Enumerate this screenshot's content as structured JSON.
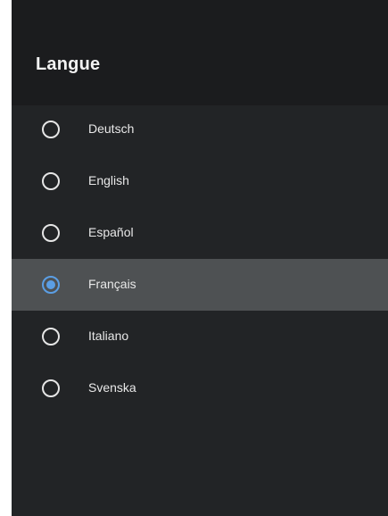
{
  "dialog": {
    "title": "Langue",
    "options": [
      {
        "label": "Deutsch",
        "selected": false
      },
      {
        "label": "English",
        "selected": false
      },
      {
        "label": "Español",
        "selected": false
      },
      {
        "label": "Français",
        "selected": true
      },
      {
        "label": "Italiano",
        "selected": false
      },
      {
        "label": "Svenska",
        "selected": false
      }
    ]
  },
  "colors": {
    "background": "#222426",
    "header": "#1b1c1e",
    "selected_row": "#4e5153",
    "accent": "#5b9ee4",
    "text": "#e8e8e8"
  }
}
